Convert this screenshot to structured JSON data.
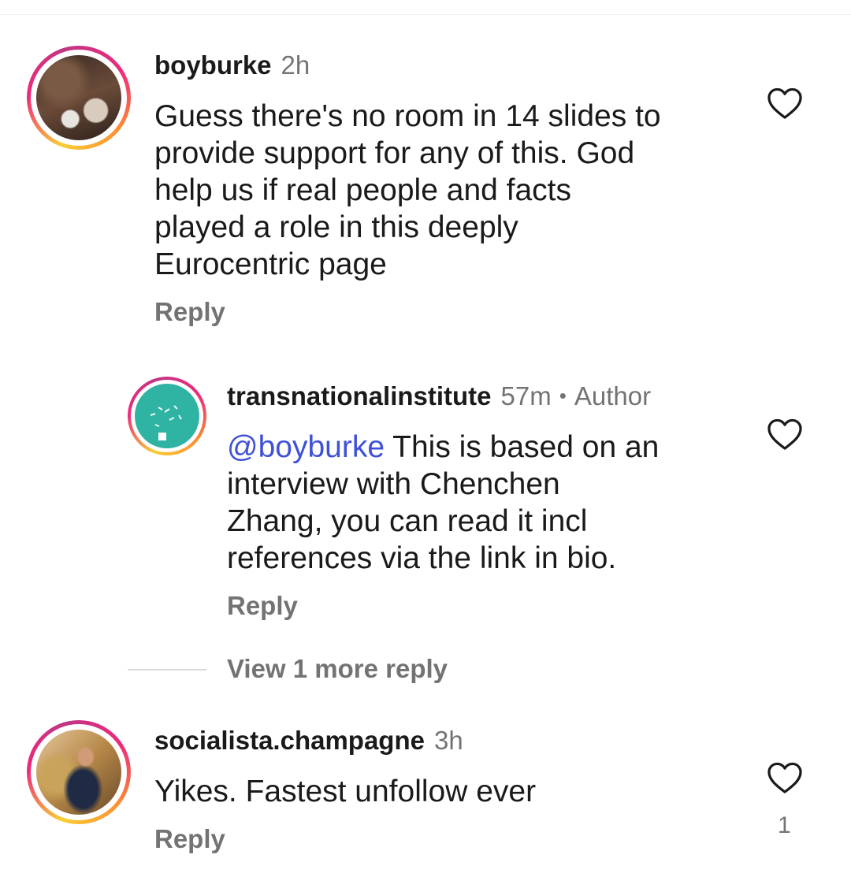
{
  "comments": [
    {
      "username": "boyburke",
      "time": "2h",
      "lines": [
        "Guess there's no room in 14 slides to",
        "provide support for any of this. God",
        "help us if real people and facts",
        "played a role in this deeply",
        "Eurocentric page"
      ],
      "reply_label": "Reply"
    },
    {
      "username": "transnationalinstitute",
      "time": "57m",
      "separator": "•",
      "author_label": "Author",
      "mention": "@boyburke",
      "lines": [
        " This is based on an",
        "interview with Chenchen",
        "Zhang, you can read it incl",
        "references via the link in bio."
      ],
      "reply_label": "Reply"
    },
    {
      "username": "socialista.champagne",
      "time": "3h",
      "lines": [
        "Yikes. Fastest unfollow ever"
      ],
      "reply_label": "Reply",
      "like_count": "1"
    }
  ],
  "view_more_replies": "View 1 more reply",
  "colors": {
    "mention": "#3f51d6",
    "muted": "#737373",
    "text": "#1a1a1a"
  }
}
